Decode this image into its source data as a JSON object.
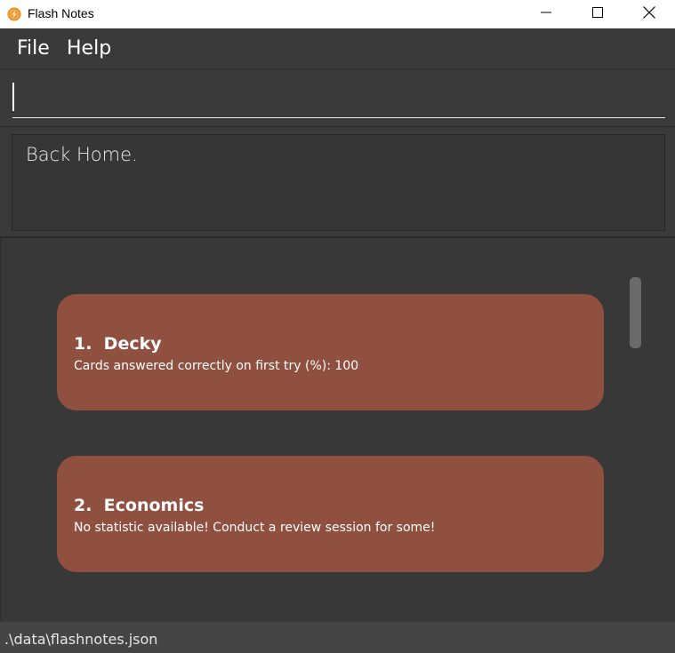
{
  "window": {
    "title": "Flash Notes",
    "icon": "flash-notes-icon"
  },
  "controls": {
    "minimize_icon": "minimize-icon",
    "maximize_icon": "maximize-icon",
    "close_icon": "close-icon"
  },
  "menu": {
    "items": [
      {
        "label": "File"
      },
      {
        "label": "Help"
      }
    ]
  },
  "command": {
    "value": ""
  },
  "result": {
    "text": "Back Home."
  },
  "decks": [
    {
      "index": "1.",
      "name": "Decky",
      "title": "1.  Decky",
      "stat": "Cards answered correctly on first try (%): 100"
    },
    {
      "index": "2.",
      "name": "Economics",
      "title": "2.  Economics",
      "stat": "No statistic available! Conduct a review session for some!"
    }
  ],
  "status": {
    "path": ".\\data\\flashnotes.json"
  },
  "colors": {
    "background": "#3a3a3a",
    "card": "#8f5040",
    "titlebar": "#ffffff",
    "statusbar": "#454545"
  }
}
